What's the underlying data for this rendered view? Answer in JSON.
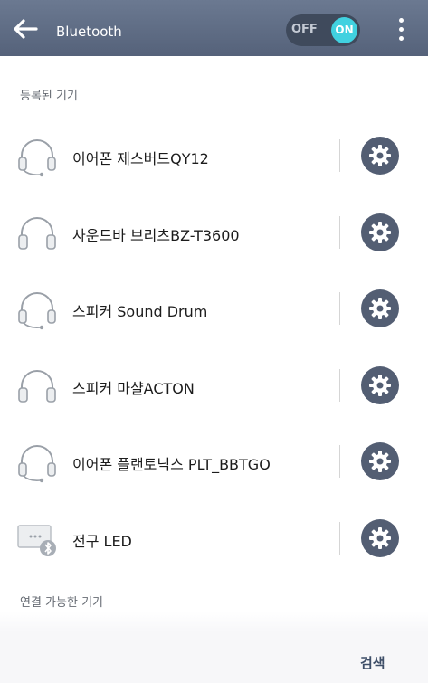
{
  "header": {
    "title": "Bluetooth",
    "toggle": {
      "off_label": "OFF",
      "on_label": "ON",
      "state": "on"
    }
  },
  "sections": {
    "paired": "등록된 기기",
    "available": "연결 가능한 기기"
  },
  "devices": [
    {
      "label": "이어폰 제스버드QY12",
      "icon": "headset-icon"
    },
    {
      "label": "사운드바 브리츠BZ-T3600",
      "icon": "headphones-icon"
    },
    {
      "label": "스피커 Sound Drum",
      "icon": "headset-icon"
    },
    {
      "label": "스피커 마샬ACTON",
      "icon": "headphones-icon"
    },
    {
      "label": "이어폰 플랜토닉스 PLT_BBTGO",
      "icon": "headset-icon"
    },
    {
      "label": "전구 LED",
      "icon": "bluetooth-device-icon"
    }
  ],
  "footer": {
    "scan_label": "검색"
  },
  "colors": {
    "header": "#5f6c84",
    "toggle_on": "#41d1e0",
    "gear_button": "#535e73"
  }
}
